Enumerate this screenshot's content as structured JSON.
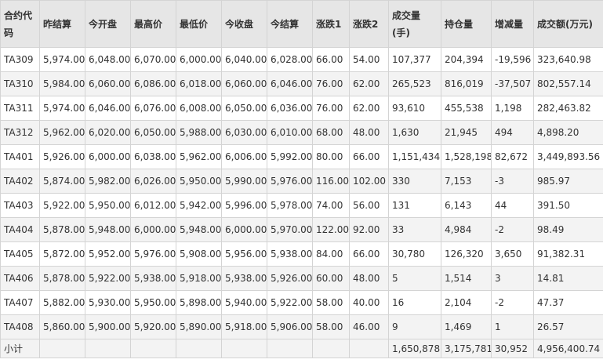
{
  "headers": [
    "合约代码",
    "昨结算",
    "今开盘",
    "最高价",
    "最低价",
    "今收盘",
    "今结算",
    "涨跌1",
    "涨跌2",
    "成交量(手)",
    "持仓量",
    "增减量",
    "成交额(万元)"
  ],
  "rows": [
    [
      "TA309",
      "5,974.00",
      "6,048.00",
      "6,070.00",
      "6,000.00",
      "6,040.00",
      "6,028.00",
      "66.00",
      "54.00",
      "107,377",
      "204,394",
      "-19,596",
      "323,640.98"
    ],
    [
      "TA310",
      "5,984.00",
      "6,060.00",
      "6,086.00",
      "6,018.00",
      "6,060.00",
      "6,046.00",
      "76.00",
      "62.00",
      "265,523",
      "816,019",
      "-37,507",
      "802,557.14"
    ],
    [
      "TA311",
      "5,974.00",
      "6,046.00",
      "6,076.00",
      "6,008.00",
      "6,050.00",
      "6,036.00",
      "76.00",
      "62.00",
      "93,610",
      "455,538",
      "1,198",
      "282,463.82"
    ],
    [
      "TA312",
      "5,962.00",
      "6,020.00",
      "6,050.00",
      "5,988.00",
      "6,030.00",
      "6,010.00",
      "68.00",
      "48.00",
      "1,630",
      "21,945",
      "494",
      "4,898.20"
    ],
    [
      "TA401",
      "5,926.00",
      "6,000.00",
      "6,038.00",
      "5,962.00",
      "6,006.00",
      "5,992.00",
      "80.00",
      "66.00",
      "1,151,434",
      "1,528,198",
      "82,672",
      "3,449,893.56"
    ],
    [
      "TA402",
      "5,874.00",
      "5,982.00",
      "6,026.00",
      "5,950.00",
      "5,990.00",
      "5,976.00",
      "116.00",
      "102.00",
      "330",
      "7,153",
      "-3",
      "985.97"
    ],
    [
      "TA403",
      "5,922.00",
      "5,950.00",
      "6,012.00",
      "5,942.00",
      "5,996.00",
      "5,978.00",
      "74.00",
      "56.00",
      "131",
      "6,143",
      "44",
      "391.50"
    ],
    [
      "TA404",
      "5,878.00",
      "5,948.00",
      "6,000.00",
      "5,948.00",
      "6,000.00",
      "5,970.00",
      "122.00",
      "92.00",
      "33",
      "4,984",
      "-2",
      "98.49"
    ],
    [
      "TA405",
      "5,872.00",
      "5,952.00",
      "5,976.00",
      "5,908.00",
      "5,956.00",
      "5,938.00",
      "84.00",
      "66.00",
      "30,780",
      "126,320",
      "3,650",
      "91,382.31"
    ],
    [
      "TA406",
      "5,878.00",
      "5,922.00",
      "5,938.00",
      "5,918.00",
      "5,938.00",
      "5,926.00",
      "60.00",
      "48.00",
      "5",
      "1,514",
      "3",
      "14.81"
    ],
    [
      "TA407",
      "5,882.00",
      "5,930.00",
      "5,950.00",
      "5,898.00",
      "5,940.00",
      "5,922.00",
      "58.00",
      "40.00",
      "16",
      "2,104",
      "-2",
      "47.37"
    ],
    [
      "TA408",
      "5,860.00",
      "5,900.00",
      "5,920.00",
      "5,890.00",
      "5,918.00",
      "5,906.00",
      "58.00",
      "46.00",
      "9",
      "1,469",
      "1",
      "26.57"
    ]
  ],
  "subtotal": [
    "小计",
    "",
    "",
    "",
    "",
    "",
    "",
    "",
    "",
    "1,650,878",
    "3,175,781",
    "30,952",
    "4,956,400.74"
  ]
}
